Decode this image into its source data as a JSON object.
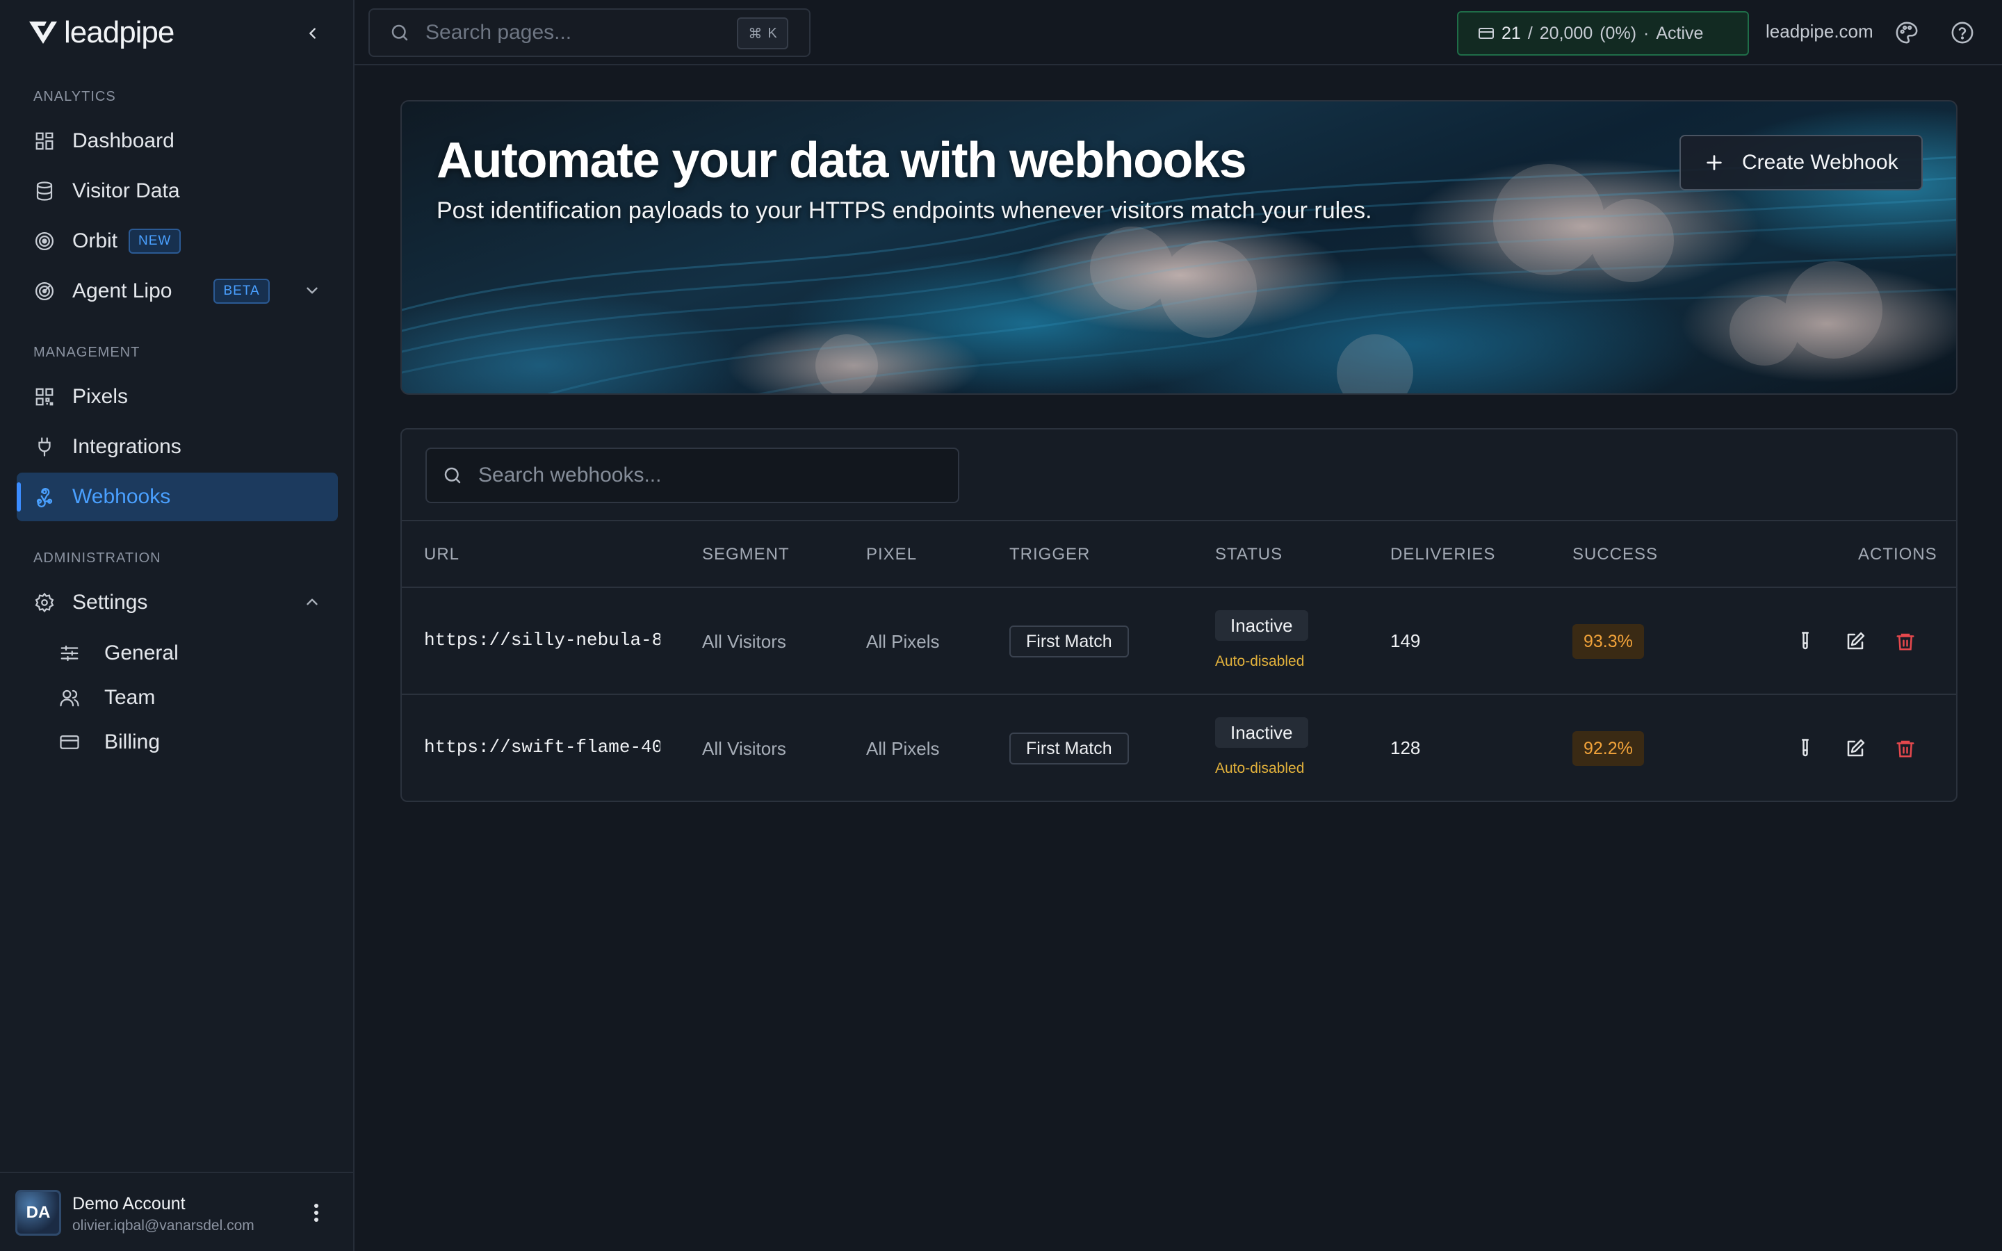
{
  "brand": {
    "name": "leadpipe"
  },
  "sidebar": {
    "sections": {
      "analytics": "ANALYTICS",
      "management": "MANAGEMENT",
      "administration": "ADMINISTRATION"
    },
    "items": {
      "dashboard": "Dashboard",
      "visitor_data": "Visitor Data",
      "orbit": "Orbit",
      "orbit_badge": "NEW",
      "agent_lipo": "Agent Lipo",
      "agent_lipo_badge": "BETA",
      "pixels": "Pixels",
      "integrations": "Integrations",
      "webhooks": "Webhooks",
      "settings": "Settings",
      "general": "General",
      "team": "Team",
      "billing": "Billing"
    },
    "active": "webhooks",
    "account": {
      "initials": "DA",
      "name": "Demo Account",
      "email": "olivier.iqbal@vanarsdel.com"
    }
  },
  "topbar": {
    "search_placeholder": "Search pages...",
    "shortcut_symbol": "⌘",
    "shortcut_key": "K",
    "usage": {
      "used": "21",
      "separator": "/",
      "limit": "20,000",
      "percent": "(0%)",
      "dot": "·",
      "status": "Active"
    },
    "domain": "leadpipe.com"
  },
  "hero": {
    "title": "Automate your data with webhooks",
    "subtitle": "Post identification payloads to your HTTPS endpoints whenever visitors match your rules.",
    "create_button": "Create Webhook"
  },
  "webhooks": {
    "search_placeholder": "Search webhooks...",
    "columns": {
      "url": "URL",
      "segment": "SEGMENT",
      "pixel": "PIXEL",
      "trigger": "TRIGGER",
      "status": "STATUS",
      "deliveries": "DELIVERIES",
      "success": "SUCCESS",
      "actions": "ACTIONS"
    },
    "rows": [
      {
        "url": "https://silly-nebula-8…",
        "segment": "All Visitors",
        "pixel": "All Pixels",
        "trigger": "First Match",
        "status": "Inactive",
        "status_note": "Auto-disabled",
        "deliveries": "149",
        "success": "93.3%"
      },
      {
        "url": "https://swift-flame-40…",
        "segment": "All Visitors",
        "pixel": "All Pixels",
        "trigger": "First Match",
        "status": "Inactive",
        "status_note": "Auto-disabled",
        "deliveries": "128",
        "success": "92.2%"
      }
    ]
  },
  "colors": {
    "accent": "#3b8cff",
    "success_bg": "#3a2a14",
    "success_text": "#f2a33a",
    "warning_text": "#e3b23c",
    "delete": "#e5484d",
    "usage_border": "#1f6d48"
  }
}
